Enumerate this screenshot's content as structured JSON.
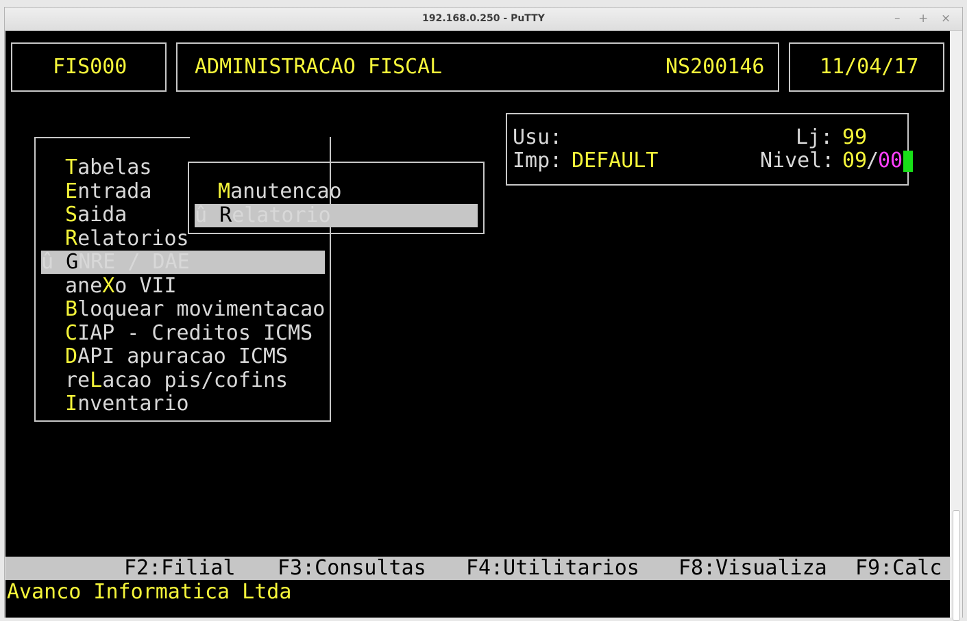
{
  "window": {
    "title": "192.168.0.250 - PuTTY",
    "min": "–",
    "max": "+",
    "close": "×"
  },
  "header": {
    "program": "FIS000",
    "module": "ADMINISTRACAO FISCAL",
    "station": "NS200146",
    "date": "11/04/17"
  },
  "info": {
    "usu_label": "Usu:",
    "usu_value": "",
    "lj_label": "Lj:",
    "lj_value": "99",
    "imp_label": "Imp:",
    "imp_value": "DEFAULT",
    "nivel_label": "Nivel:",
    "nivel_a": "09",
    "nivel_sep": "/",
    "nivel_b": "00"
  },
  "menu": {
    "marker": "û",
    "items": [
      {
        "pre": "",
        "key": "T",
        "post": "abelas"
      },
      {
        "pre": "",
        "key": "E",
        "post": "ntrada"
      },
      {
        "pre": "",
        "key": "S",
        "post": "aida"
      },
      {
        "pre": "",
        "key": "R",
        "post": "elatorios"
      },
      {
        "pre": "",
        "key": "G",
        "post": "NRE / DAE",
        "selected": true
      },
      {
        "pre": "ane",
        "key": "X",
        "post": "o VII"
      },
      {
        "pre": "",
        "key": "B",
        "post": "loquear movimentacao"
      },
      {
        "pre": "",
        "key": "C",
        "post": "IAP - Creditos ICMS"
      },
      {
        "pre": "",
        "key": "D",
        "post": "API apuracao ICMS"
      },
      {
        "pre": "re",
        "key": "L",
        "post": "acao pis/cofins"
      },
      {
        "pre": "",
        "key": "I",
        "post": "nventario"
      }
    ]
  },
  "submenu": {
    "items": [
      {
        "pre": "",
        "key": "M",
        "post": "anutencao"
      },
      {
        "pre": "",
        "key": "R",
        "post": "elatorio",
        "selected": true
      }
    ]
  },
  "fkeys": [
    "F2:Filial",
    "F3:Consultas",
    "F4:Utilitarios",
    "F8:Visualiza",
    "F9:Calc"
  ],
  "footer": {
    "company": "Avanco Informatica Ltda"
  },
  "colors": {
    "terminal_bg": "#000000",
    "highlight_text": "#f5f53a",
    "magenta": "#ff3fff",
    "cursor": "#18e018",
    "selection_bg": "#c6c6c6"
  }
}
